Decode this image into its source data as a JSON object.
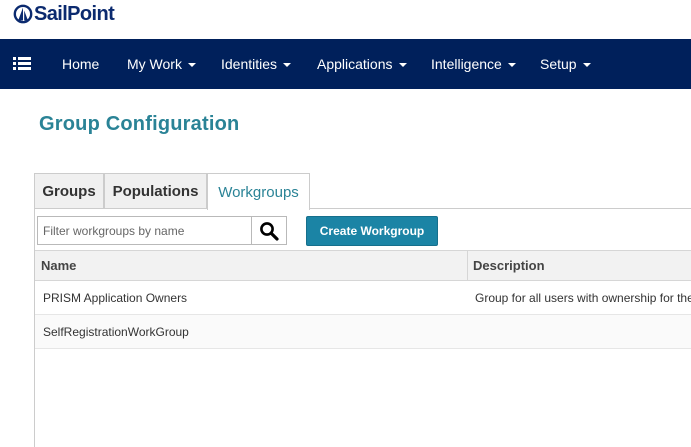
{
  "brand": {
    "logo_text": "SailPoint",
    "color": "#0b2a6f"
  },
  "nav": {
    "menu_icon": "hamburger-list-icon",
    "items": [
      {
        "label": "Home",
        "dropdown": false
      },
      {
        "label": "My Work",
        "dropdown": true
      },
      {
        "label": "Identities",
        "dropdown": true
      },
      {
        "label": "Applications",
        "dropdown": true
      },
      {
        "label": "Intelligence",
        "dropdown": true
      },
      {
        "label": "Setup",
        "dropdown": true
      }
    ],
    "background": "#00205b"
  },
  "page": {
    "title": "Group Configuration",
    "title_color": "#2a8396"
  },
  "tabs": [
    {
      "label": "Groups",
      "active": false
    },
    {
      "label": "Populations",
      "active": false
    },
    {
      "label": "Workgroups",
      "active": true
    }
  ],
  "toolbar": {
    "search_placeholder": "Filter workgroups by name",
    "search_value": "",
    "search_icon": "magnifier-icon",
    "create_label": "Create Workgroup",
    "create_color": "#1b84a5"
  },
  "table": {
    "columns": [
      "Name",
      "Description"
    ],
    "rows": [
      {
        "name": "PRISM Application Owners",
        "description": "Group for all users with ownership for the"
      },
      {
        "name": "SelfRegistrationWorkGroup",
        "description": ""
      }
    ]
  }
}
